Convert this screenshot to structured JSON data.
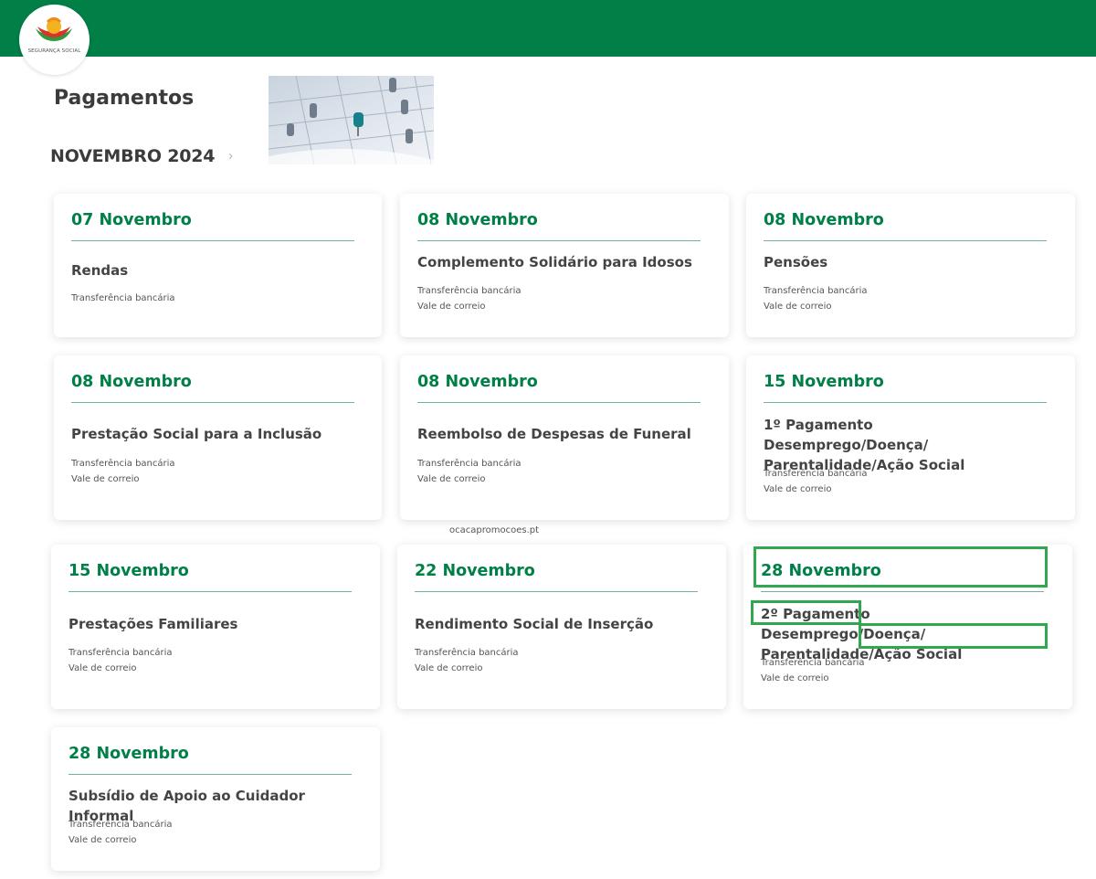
{
  "header": {
    "logo_text": "SEGURANÇA SOCIAL",
    "brand_color": "#007f47"
  },
  "page": {
    "title": "Pagamentos",
    "month": "NOVEMBRO 2024",
    "month_arrow_icon": "chevron-right-icon"
  },
  "cards": [
    {
      "date": "07 Novembro",
      "title": "Rendas",
      "methods": [
        "Transferência bancária"
      ]
    },
    {
      "date": "08 Novembro",
      "title": "Complemento Solidário para Idosos",
      "methods": [
        "Transferência bancária",
        "Vale de correio"
      ]
    },
    {
      "date": "08 Novembro",
      "title": "Pensões",
      "methods": [
        "Transferência bancária",
        "Vale de correio"
      ]
    },
    {
      "date": "08 Novembro",
      "title": "Prestação Social para a Inclusão",
      "methods": [
        "Transferência bancária",
        "Vale de correio"
      ]
    },
    {
      "date": "08 Novembro",
      "title": "Reembolso de Despesas de Funeral",
      "methods": [
        "Transferência bancária",
        "Vale de correio"
      ]
    },
    {
      "date": "15 Novembro",
      "title": "1º Pagamento Desemprego/Doença/ Parentalidade/Ação Social",
      "methods": [
        "Transferência bancária",
        "Vale de correio"
      ]
    },
    {
      "date": "15 Novembro",
      "title": "Prestações Familiares",
      "methods": [
        "Transferência bancária",
        "Vale de correio"
      ]
    },
    {
      "date": "22 Novembro",
      "title": "Rendimento Social de Inserção",
      "methods": [
        "Transferência bancária",
        "Vale de correio"
      ]
    },
    {
      "date": "28 Novembro",
      "title": "2º Pagamento Desemprego/Doença/ Parentalidade/Ação Social",
      "methods": [
        "Transferência bancária",
        "Vale de correio"
      ]
    },
    {
      "date": "28 Novembro",
      "title": "Subsídio de Apoio ao Cuidador Informal",
      "methods": [
        "Transferência bancária",
        "Vale de correio"
      ]
    }
  ],
  "watermark": "ocacapromocoes.pt",
  "highlight_color": "#31a84f"
}
